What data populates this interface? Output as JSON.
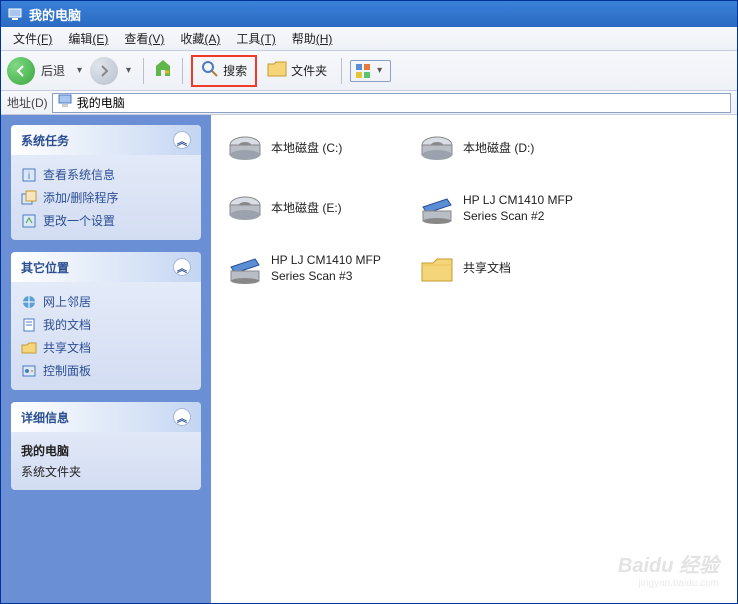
{
  "window": {
    "title": "我的电脑"
  },
  "menu": {
    "file": "文件",
    "file_key": "(F)",
    "edit": "编辑",
    "edit_key": "(E)",
    "view": "查看",
    "view_key": "(V)",
    "favorites": "收藏",
    "favorites_key": "(A)",
    "tools": "工具",
    "tools_key": "(T)",
    "help": "帮助",
    "help_key": "(H)"
  },
  "toolbar": {
    "back": "后退",
    "search": "搜索",
    "folders": "文件夹"
  },
  "addressbar": {
    "label": "地址",
    "label_key": "(D)",
    "value": "我的电脑"
  },
  "sidebar": {
    "system_tasks": {
      "title": "系统任务",
      "items": [
        {
          "icon": "info",
          "label": "查看系统信息"
        },
        {
          "icon": "addremove",
          "label": "添加/删除程序"
        },
        {
          "icon": "setting",
          "label": "更改一个设置"
        }
      ]
    },
    "other_places": {
      "title": "其它位置",
      "items": [
        {
          "icon": "network",
          "label": "网上邻居"
        },
        {
          "icon": "mydocs",
          "label": "我的文档"
        },
        {
          "icon": "shared",
          "label": "共享文档"
        },
        {
          "icon": "control",
          "label": "控制面板"
        }
      ]
    },
    "details": {
      "title": "详细信息",
      "name": "我的电脑",
      "type": "系统文件夹"
    }
  },
  "content": {
    "items": [
      {
        "type": "drive",
        "label": "本地磁盘 (C:)"
      },
      {
        "type": "drive",
        "label": "本地磁盘 (D:)"
      },
      {
        "type": "drive",
        "label": "本地磁盘 (E:)"
      },
      {
        "type": "scanner",
        "label": "HP LJ CM1410 MFP Series Scan #2"
      },
      {
        "type": "scanner",
        "label": "HP LJ CM1410 MFP Series Scan #3"
      },
      {
        "type": "folder",
        "label": "共享文档"
      }
    ]
  },
  "watermark": {
    "main": "Baidu 经验",
    "sub": "jingyan.baidu.com"
  }
}
